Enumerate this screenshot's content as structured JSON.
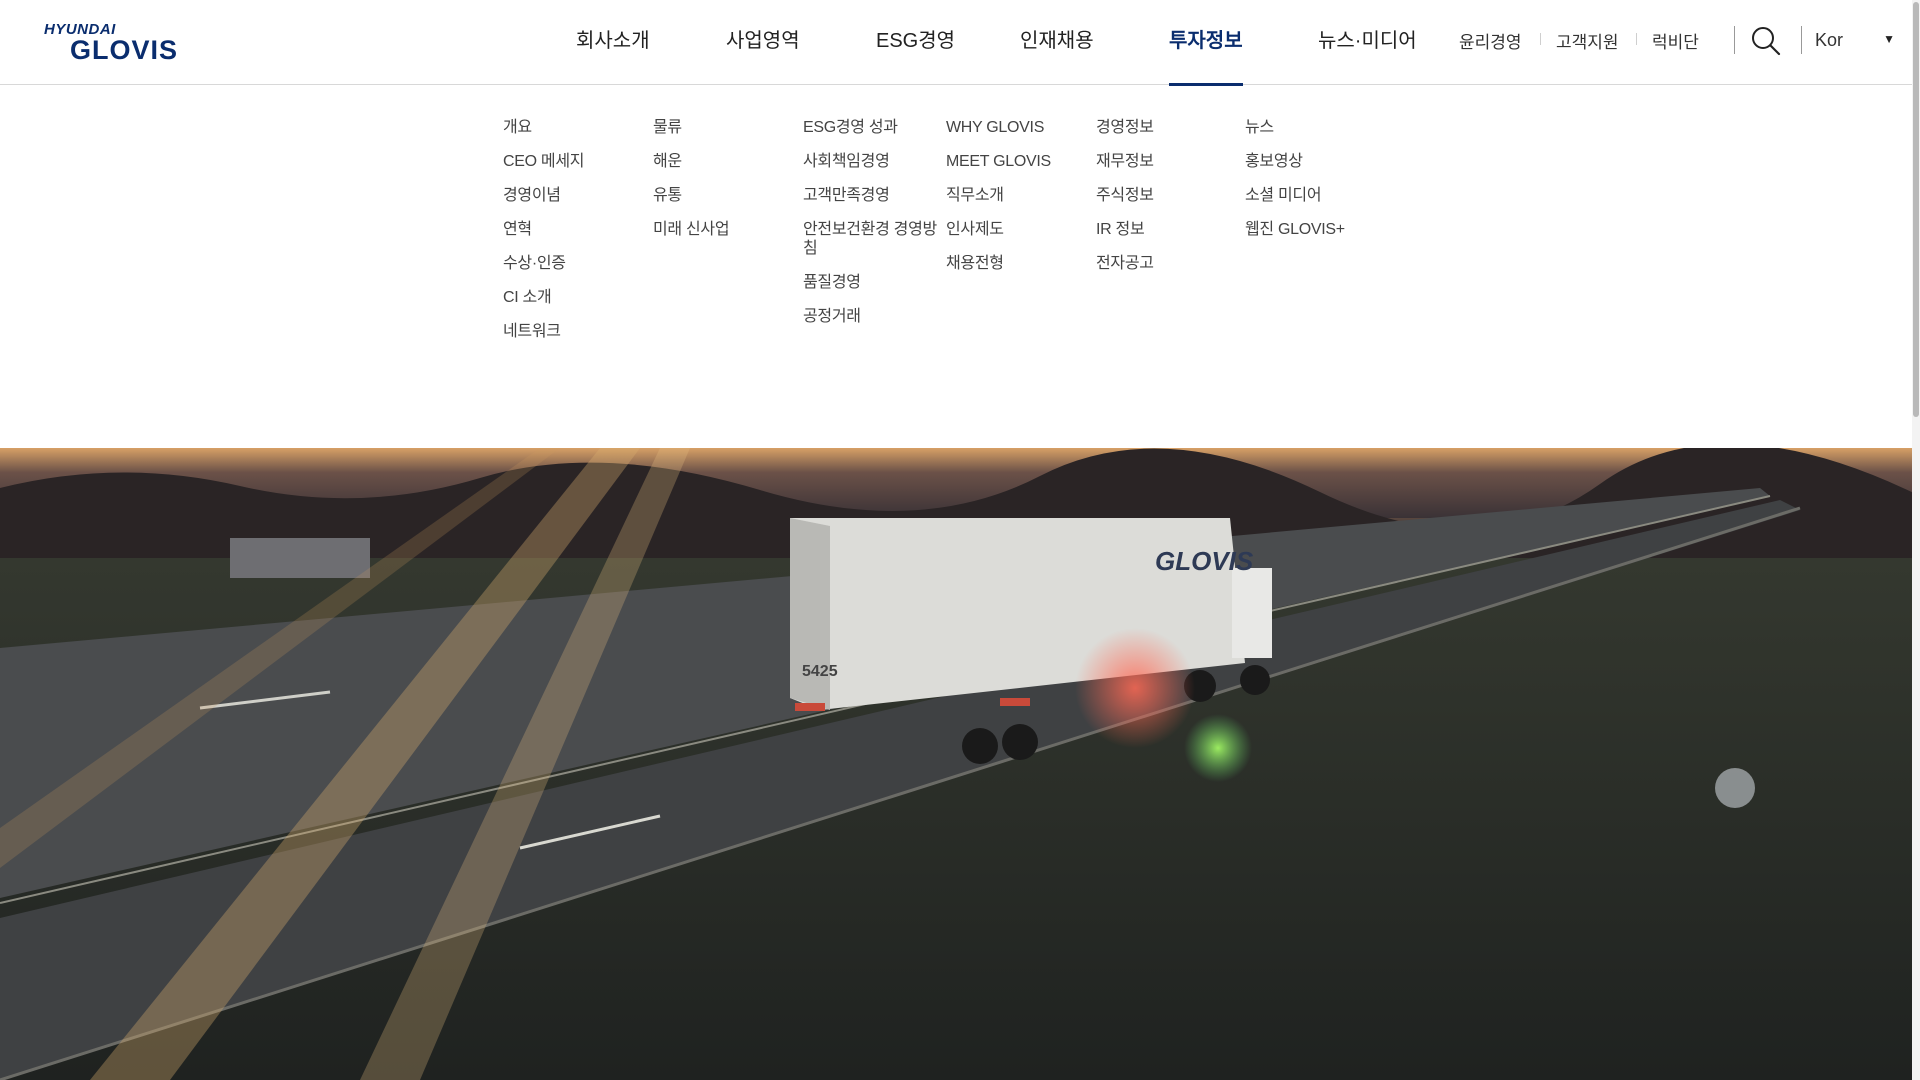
{
  "brand": {
    "top": "HYUNDAI",
    "main": "GLOVIS"
  },
  "gnb": [
    {
      "label": "회사소개",
      "active": false
    },
    {
      "label": "사업영역",
      "active": false
    },
    {
      "label": "ESG경영",
      "active": false
    },
    {
      "label": "인재채용",
      "active": false
    },
    {
      "label": "투자정보",
      "active": true
    },
    {
      "label": "뉴스·미디어",
      "active": false
    }
  ],
  "util": [
    "윤리경영",
    "고객지원",
    "럭비단"
  ],
  "lang": {
    "label": "Kor",
    "arrow": "▼"
  },
  "icons": {
    "search": "search-icon",
    "dropdown": "caret-down-icon"
  },
  "submenu": [
    [
      "개요",
      "CEO 메세지",
      "경영이념",
      "연혁",
      "수상·인증",
      "CI 소개",
      "네트워크"
    ],
    [
      "물류",
      "해운",
      "유통",
      "미래 신사업"
    ],
    [
      "ESG경영 성과",
      "사회책임경영",
      "고객만족경영",
      "안전보건환경 경영방침",
      "품질경영",
      "공정거래"
    ],
    [
      "WHY GLOVIS",
      "MEET GLOVIS",
      "직무소개",
      "인사제도",
      "채용전형"
    ],
    [
      "경영정보",
      "재무정보",
      "주식정보",
      "IR 정보",
      "전자공고"
    ],
    [
      "뉴스",
      "홍보영상",
      "소셜 미디어",
      "웹진 GLOVIS+"
    ]
  ],
  "hero": {
    "truck_text": "GLOVIS",
    "trailer_number": "5425"
  },
  "colors": {
    "brand_navy": "#0a2d6e",
    "active_underline": "#0a2d6e"
  }
}
